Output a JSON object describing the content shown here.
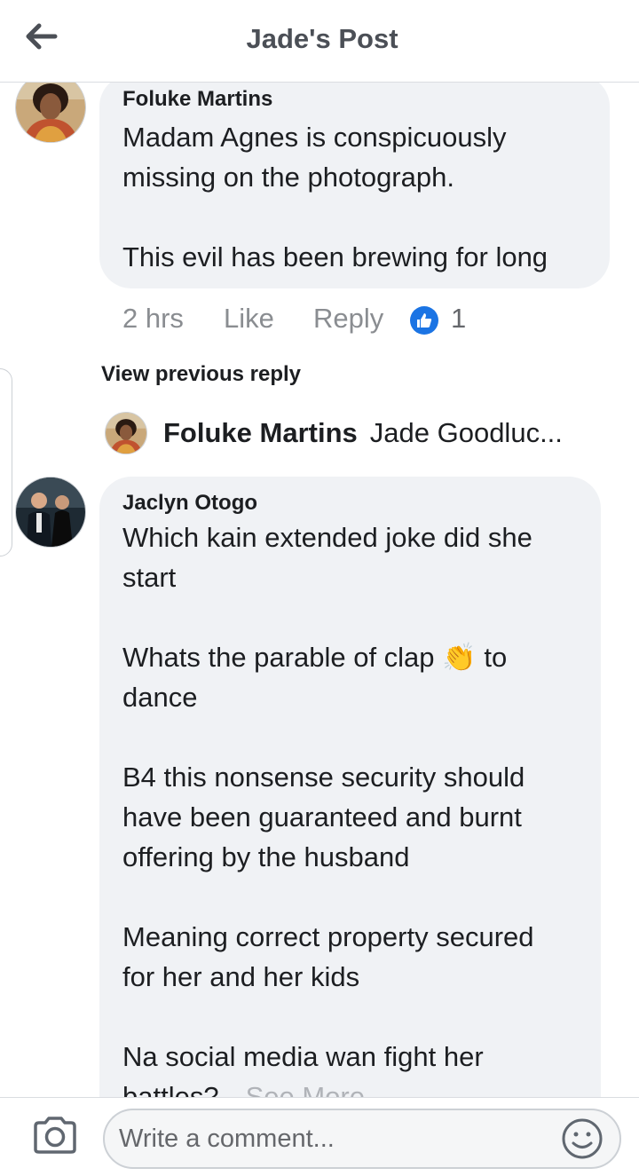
{
  "header": {
    "title": "Jade's Post"
  },
  "comments": [
    {
      "author": "Foluke Martins",
      "lines": [
        "Madam Agnes is conspicuously",
        "missing on the photograph.",
        "",
        "This evil has been brewing for long"
      ],
      "time": "2 hrs",
      "like_label": "Like",
      "reply_label": "Reply",
      "reaction_count": "1"
    },
    {
      "author": "Jaclyn Otogo",
      "lines": [
        "Which kain extended joke did she",
        "start",
        "",
        "Whats the parable of clap 👏 to",
        "dance",
        "",
        "B4 this nonsense security should",
        "have been guaranteed  and burnt",
        "offering by the husband",
        "",
        "Meaning correct property secured",
        "for her and her kids",
        "",
        "Na social media wan fight her",
        "battles?"
      ],
      "see_more": "See More"
    }
  ],
  "replies": {
    "view_previous": "View previous reply",
    "latest": {
      "author": "Foluke Martins",
      "text": "Jade Goodluc..."
    }
  },
  "composer": {
    "placeholder": "Write a comment..."
  },
  "colors": {
    "bubble": "#f0f2f5",
    "like_blue": "#1b74e4",
    "muted": "#8a8d91"
  }
}
